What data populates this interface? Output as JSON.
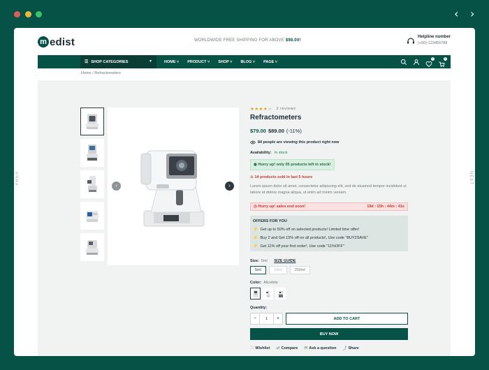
{
  "browser": {
    "dot_colors": [
      "#e05c5c",
      "#e6bb3b",
      "#3cc46a"
    ],
    "prev_icon": "chevron-left-icon",
    "next_icon": "chevron-right-icon"
  },
  "side": {
    "prev_label": "PREV",
    "next_label": "NEXT"
  },
  "header": {
    "logo_mark": "m",
    "logo_text": "edist",
    "shipping_text": "WORLDWIDE FREE SHIPPING FOR ABOVE",
    "shipping_amount": "$98.00!",
    "helpline_title": "Helpline number",
    "helpline_phone": "(+00)-123456789"
  },
  "nav": {
    "categories_label": "SHOP CATEGORIES",
    "menu": [
      {
        "label": "HOME"
      },
      {
        "label": "PRODUCT"
      },
      {
        "label": "SHOP"
      },
      {
        "label": "BLOG"
      },
      {
        "label": "PAGE"
      }
    ],
    "wishlist_count": "0",
    "cart_count": "0"
  },
  "breadcrumb": "Home / Refractometers",
  "product": {
    "rating": 4,
    "reviews": "2 reviews",
    "title": "Refractometers",
    "price": "$79.00",
    "old_price": "$89.00",
    "discount": "(-11%)",
    "viewing": "84 people are viewing this product right now",
    "availability_label": "Availability:",
    "availability_value": "In stock",
    "stock_alert": "Hurry up! only 05 products left in stock!",
    "sold_text": "14 products sold in last 5 hours",
    "description": "Lorem ipsum dolor sit amet, consectetur adipiscing elit, sed do eiusmod tempor incididunt ut labore et dolore magna aliqua, ut enim ad minim veniam.",
    "sale_label": "Hurry up! sales end soon!",
    "countdown": "19d : 15h : 44m : 41s",
    "offers_title": "OFFERS FOR YOU",
    "offers": [
      "Get up to 50% off on selected products! Limited time offer!",
      "Buy 2 and Get 15% off on all products!, Use code \"BUY2SAVE\"",
      "Get 11% off your first order!, Use code \"11%OFF\""
    ],
    "size_label": "Size:",
    "size_selected": "5ml",
    "size_guide": "SIZE GUIDE",
    "sizes": [
      "5ml",
      "10ml",
      "250ml"
    ],
    "color_label": "Color:",
    "color_selected": "Alicebite",
    "quantity_label": "Quantity:",
    "quantity": "1",
    "add_to_cart": "ADD TO CART",
    "buy_now": "BUY NOW",
    "actions": [
      "Wishlist",
      "Compare",
      "Ask a question",
      "Share"
    ]
  },
  "colors": {
    "brand": "#075246",
    "star": "#e3a21a",
    "success": "#1e8a4c",
    "danger": "#c0392b"
  }
}
